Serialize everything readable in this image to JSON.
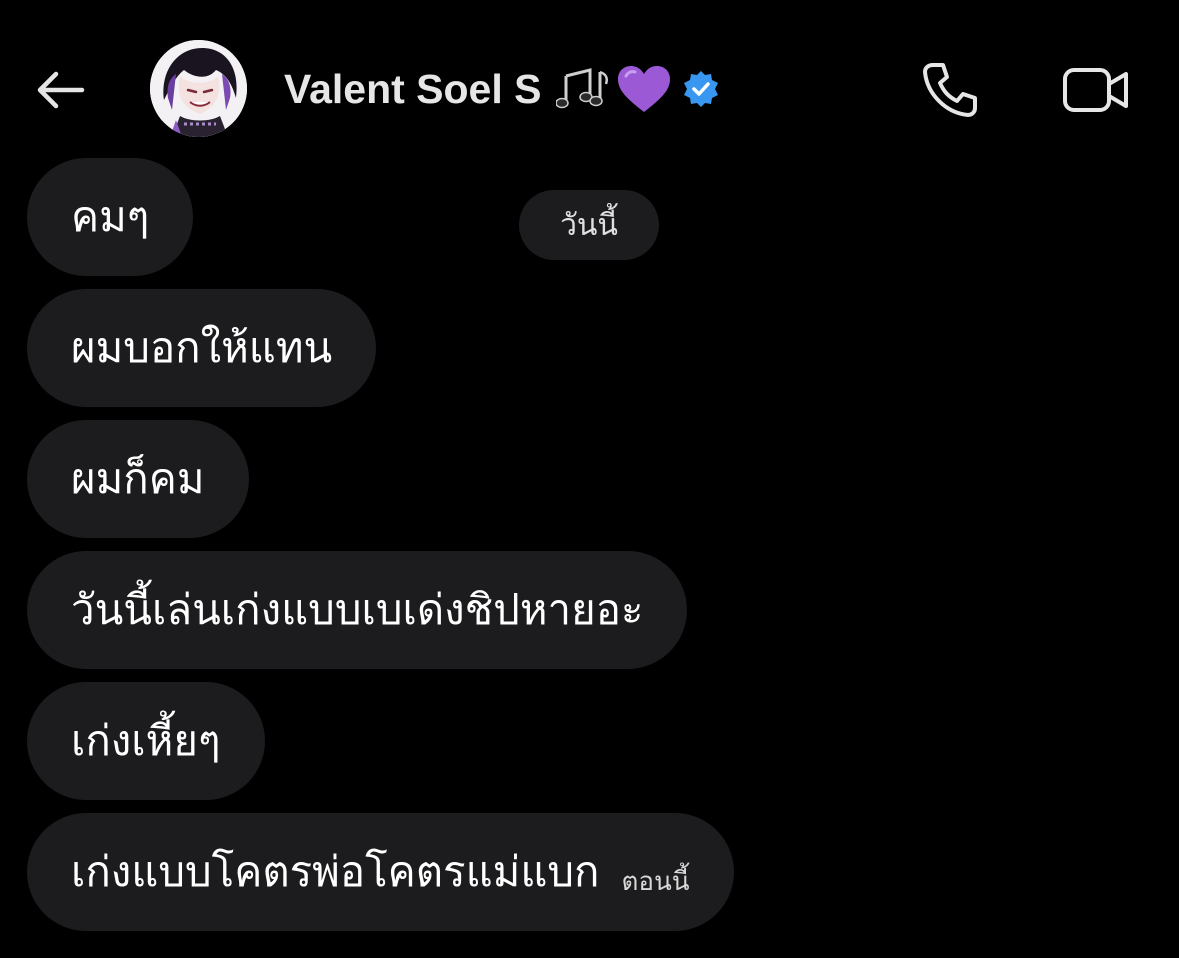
{
  "header": {
    "contact_name": "Valent Soel S",
    "name_emoji": [
      "musical-notes",
      "purple-heart"
    ],
    "verified": true,
    "icons": {
      "back": "arrow-left-icon",
      "call": "phone-icon",
      "video": "video-camera-icon"
    }
  },
  "date_separator": "วันนี้",
  "messages": [
    {
      "text": "คมๆ",
      "time": ""
    },
    {
      "text": "ผมบอกให้แทน",
      "time": ""
    },
    {
      "text": "ผมก็คม",
      "time": ""
    },
    {
      "text": "วันนี้เล่นเก่งแบบเบเด่งชิปหายอะ",
      "time": ""
    },
    {
      "text": "เก่งเหี้ยๆ",
      "time": ""
    },
    {
      "text": "เก่งแบบโคตรพ่อโคตรแม่แบก",
      "time": "ตอนนี้"
    }
  ],
  "colors": {
    "background": "#000000",
    "bubble": "#1c1c1e",
    "verified": "#3897f0",
    "heart": "#9b59d6"
  }
}
